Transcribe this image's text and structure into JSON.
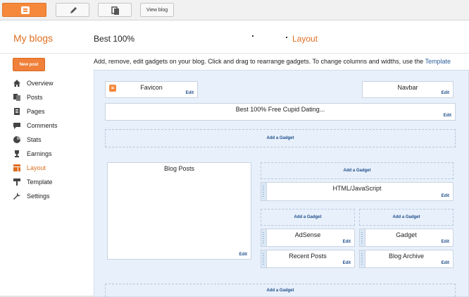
{
  "toolbar": {
    "view_blog_label": "View blog"
  },
  "header": {
    "my_blogs": "My blogs",
    "blog_title": "Best 100%",
    "page_title": "Layout"
  },
  "sidebar": {
    "new_post": "New post",
    "items": [
      {
        "label": "Overview",
        "icon": "home-icon"
      },
      {
        "label": "Posts",
        "icon": "posts-icon"
      },
      {
        "label": "Pages",
        "icon": "pages-icon"
      },
      {
        "label": "Comments",
        "icon": "comments-icon"
      },
      {
        "label": "Stats",
        "icon": "stats-icon"
      },
      {
        "label": "Earnings",
        "icon": "trophy-icon"
      },
      {
        "label": "Layout",
        "icon": "layout-icon"
      },
      {
        "label": "Template",
        "icon": "template-icon"
      },
      {
        "label": "Settings",
        "icon": "wrench-icon"
      }
    ]
  },
  "description": {
    "text": "Add, remove, edit gadgets on your blog. Click and drag to rearrange gadgets. To change columns and widths, use the ",
    "link": "Template"
  },
  "layout": {
    "edit_label": "Edit",
    "add_gadget": "Add a Gadget",
    "favicon": "Favicon",
    "navbar": "Navbar",
    "header_gadget": "Best 100% Free Cupid Dating...",
    "blog_posts": "Blog Posts",
    "html_js": "HTML/JavaScript",
    "adsense": "AdSense",
    "gadget": "Gadget",
    "recent_posts": "Recent Posts",
    "blog_archive": "Blog Archive"
  },
  "colors": {
    "accent": "#dd6e21",
    "blogger_orange": "#f5883a",
    "canvas_bg": "#e8f0fb",
    "link": "#2b5e9a"
  }
}
